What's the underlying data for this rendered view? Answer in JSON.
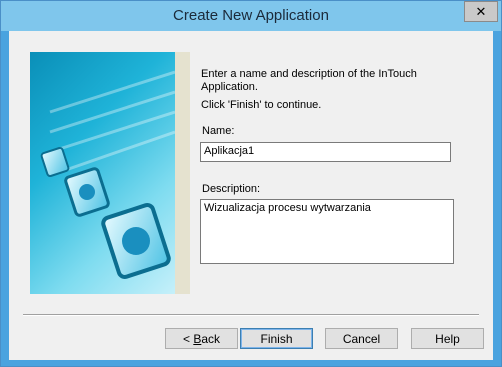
{
  "window": {
    "title": "Create New Application",
    "close_symbol": "✕"
  },
  "intro": {
    "line1": "Enter a name and description of the InTouch",
    "line2": "Application.",
    "line3": "Click 'Finish' to continue."
  },
  "name_field": {
    "label": "Name:",
    "value": "Aplikacja1"
  },
  "description_field": {
    "label": "Description:",
    "value": "Wizualizacja procesu wytwarzania"
  },
  "buttons": {
    "back_prefix": "< ",
    "back_accel": "B",
    "back_rest": "ack",
    "finish": "Finish",
    "cancel": "Cancel",
    "help": "Help"
  },
  "colors": {
    "title_bar": "#7fc6ec",
    "window_border": "#4aa3df",
    "banner": "#1fb3d8"
  }
}
